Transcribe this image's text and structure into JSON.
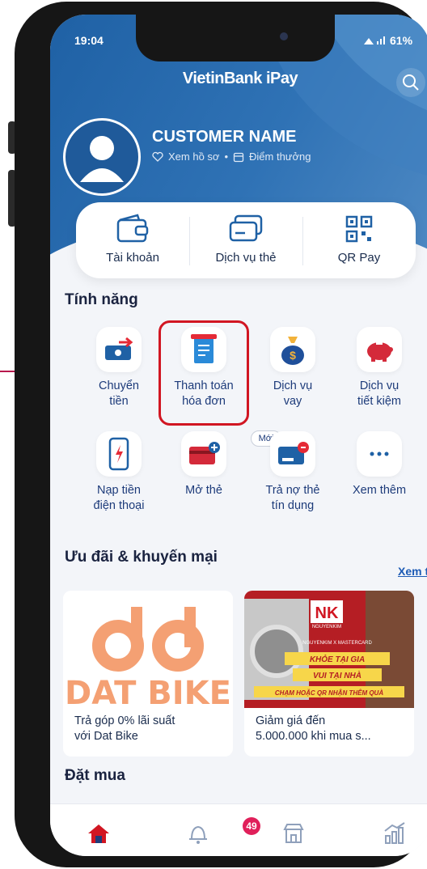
{
  "status_bar": {
    "time": "19:04",
    "battery": "61%"
  },
  "header": {
    "brand": "VietinBank iPay"
  },
  "profile": {
    "name": "CUSTOMER NAME",
    "view_profile": "Xem hồ sơ",
    "separator": "•",
    "points": "Điểm thưởng"
  },
  "quick_actions": [
    {
      "label": "Tài khoản",
      "icon": "wallet-icon"
    },
    {
      "label": "Dịch vụ thẻ",
      "icon": "card-icon"
    },
    {
      "label": "QR Pay",
      "icon": "qr-code-icon"
    }
  ],
  "features": {
    "title": "Tính năng",
    "items": [
      {
        "line1": "Chuyển",
        "line2": "tiền",
        "icon": "money-transfer-icon"
      },
      {
        "line1": "Thanh toán",
        "line2": "hóa đơn",
        "icon": "bill-payment-icon"
      },
      {
        "line1": "Dịch vụ",
        "line2": "vay",
        "icon": "loan-bag-icon"
      },
      {
        "line1": "Dịch vụ",
        "line2": "tiết kiệm",
        "icon": "piggy-bank-icon"
      },
      {
        "line1": "Nạp tiền",
        "line2": "điện thoại",
        "icon": "phone-topup-icon"
      },
      {
        "line1": "Mở thẻ",
        "line2": "",
        "icon": "open-card-icon"
      },
      {
        "line1": "Trả nợ thẻ",
        "line2": "tín dụng",
        "icon": "credit-card-pay-icon"
      },
      {
        "line1": "Xem thêm",
        "line2": "",
        "icon": "more-icon"
      }
    ],
    "new_badge": "Mới"
  },
  "promotions": {
    "title": "Ưu đãi & khuyến mại",
    "see_all": "Xem tất c",
    "items": [
      {
        "brand": "DAT BIKE",
        "line1": "Trả góp 0% lãi suất",
        "line2": "với Dat Bike"
      },
      {
        "brand": "NK",
        "sub_brand": "NGUYENKIM",
        "banner1": "KHỎE TẠI GIA",
        "banner2": "VUI TẠI NHÀ",
        "banner3": "CHẠM HOẶC QR NHẬN THÊM QUÀ",
        "tagline": "NGUYENKIM X MASTERCARD",
        "line1": "Giảm giá đến",
        "line2": "5.000.000 khi mua s..."
      }
    ]
  },
  "order_section": {
    "title": "Đặt mua"
  },
  "tabbar": {
    "items": [
      {
        "name": "home",
        "icon": "home-icon"
      },
      {
        "name": "notifications",
        "icon": "bell-icon"
      },
      {
        "name": "store",
        "icon": "store-icon"
      },
      {
        "name": "investment",
        "icon": "chart-icon"
      }
    ],
    "notification_count": "49"
  },
  "colors": {
    "primary": "#1f61a5",
    "highlight": "#d11622",
    "accent": "#e0205a",
    "dat_bike": "#f4a073"
  }
}
